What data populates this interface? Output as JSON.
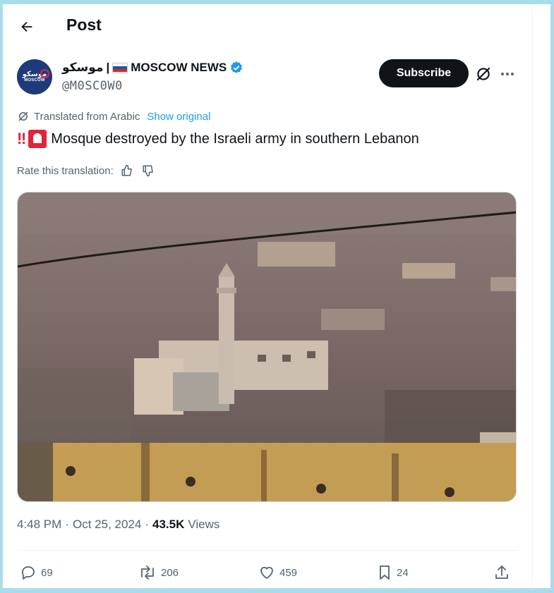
{
  "header": {
    "title": "Post"
  },
  "author": {
    "avatar_text": "موسكو",
    "avatar_subtext": "MOSCOW",
    "name_arabic": "موسكو",
    "separator": "|",
    "name": "MOSCOW NEWS",
    "handle": "@M0SC0W0",
    "verified_color": "#1d9bf0"
  },
  "actions_top": {
    "subscribe_label": "Subscribe"
  },
  "translation": {
    "label": "Translated from Arabic",
    "show_original": "Show original",
    "rate_label": "Rate this translation:"
  },
  "tweet": {
    "emoji_text": "‼",
    "text": "Mosque destroyed by the Israeli army in southern Lebanon"
  },
  "meta": {
    "time": "4:48 PM",
    "date": "Oct 25, 2024",
    "views_count": "43.5K",
    "views_label": "Views",
    "dot": "·"
  },
  "stats": {
    "replies": "69",
    "reposts": "206",
    "likes": "459",
    "bookmarks": "24"
  },
  "colors": {
    "accent": "#1d9bf0",
    "text": "#0f1419",
    "secondary": "#536471",
    "background": "#a9dcea"
  }
}
